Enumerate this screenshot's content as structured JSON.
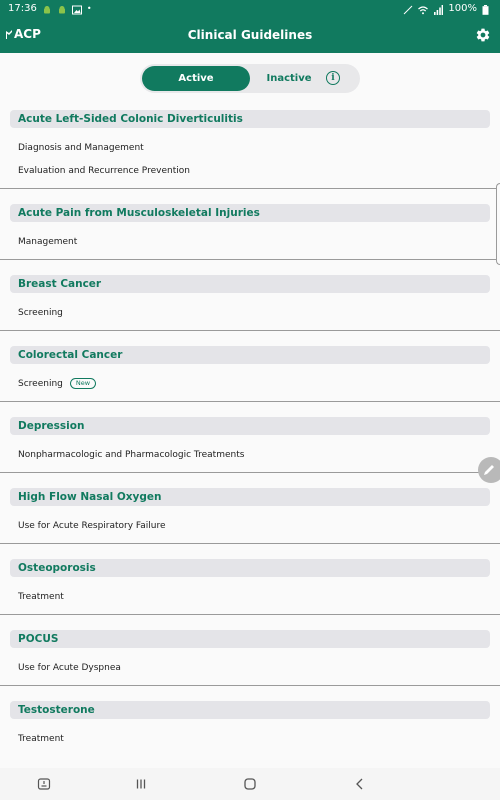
{
  "status_bar": {
    "time": "17:36",
    "battery": "100%"
  },
  "header": {
    "logo": "ACP",
    "title": "Clinical Guidelines"
  },
  "tabs": {
    "active_label": "Active",
    "inactive_label": "Inactive"
  },
  "sections": [
    {
      "title": "Acute Left-Sided Colonic Diverticulitis",
      "items": [
        "Diagnosis and Management",
        "Evaluation and Recurrence Prevention"
      ]
    },
    {
      "title": "Acute Pain from Musculoskeletal Injuries",
      "items": [
        "Management"
      ]
    },
    {
      "title": "Breast Cancer",
      "items": [
        "Screening"
      ]
    },
    {
      "title": "Colorectal Cancer",
      "items": [
        "Screening"
      ],
      "badge": "New"
    },
    {
      "title": "Depression",
      "items": [
        "Nonpharmacologic and Pharmacologic Treatments"
      ]
    },
    {
      "title": "High Flow Nasal Oxygen",
      "items": [
        "Use for Acute Respiratory Failure"
      ]
    },
    {
      "title": "Osteoporosis",
      "items": [
        "Treatment"
      ]
    },
    {
      "title": "POCUS",
      "items": [
        "Use for Acute Dyspnea"
      ]
    },
    {
      "title": "Testosterone",
      "items": [
        "Treatment"
      ]
    }
  ],
  "colors": {
    "brand": "#117a5f",
    "section_bg": "#e4e4e8",
    "divider": "#9a9a9a"
  },
  "icons": {
    "settings": "gear-icon",
    "info": "info-icon",
    "edit": "pencil-icon"
  }
}
